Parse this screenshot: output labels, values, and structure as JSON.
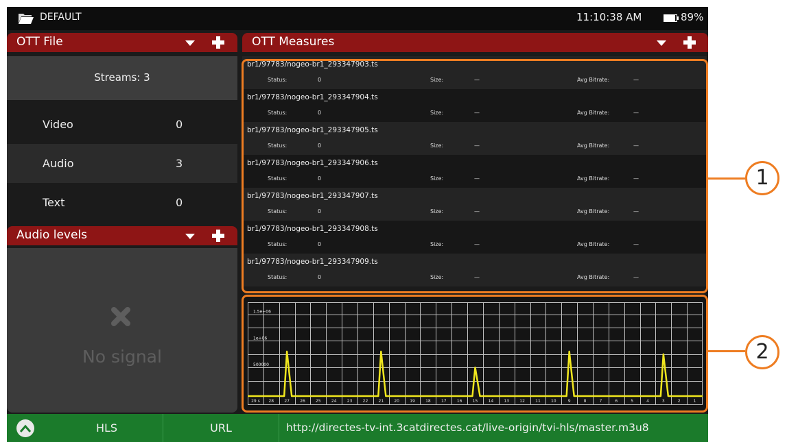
{
  "topbar": {
    "profile": "DEFAULT",
    "time": "11:10:38 AM",
    "battery": "89%",
    "icons": {
      "folder": "folder-open-icon",
      "battery": "battery-icon"
    }
  },
  "ott_file": {
    "title": "OTT File",
    "streams": "Streams: 3",
    "rows": [
      {
        "label": "Video",
        "value": "0"
      },
      {
        "label": "Audio",
        "value": "3"
      },
      {
        "label": "Text",
        "value": "0"
      }
    ]
  },
  "audio_levels": {
    "title": "Audio levels",
    "no_signal": "No signal",
    "icon": "x-icon"
  },
  "ott_measures": {
    "title": "OTT Measures",
    "status_label": "Status:",
    "size_label": "Size:",
    "bitrate_label": "Avg Bitrate:",
    "items": [
      {
        "file": "br1/97783/nogeo-br1_293347903.ts",
        "status": "0",
        "size": "—",
        "bitrate": "—"
      },
      {
        "file": "br1/97783/nogeo-br1_293347904.ts",
        "status": "0",
        "size": "—",
        "bitrate": "—"
      },
      {
        "file": "br1/97783/nogeo-br1_293347905.ts",
        "status": "0",
        "size": "—",
        "bitrate": "—"
      },
      {
        "file": "br1/97783/nogeo-br1_293347906.ts",
        "status": "0",
        "size": "—",
        "bitrate": "—"
      },
      {
        "file": "br1/97783/nogeo-br1_293347907.ts",
        "status": "0",
        "size": "—",
        "bitrate": "—"
      },
      {
        "file": "br1/97783/nogeo-br1_293347908.ts",
        "status": "0",
        "size": "—",
        "bitrate": "—"
      },
      {
        "file": "br1/97783/nogeo-br1_293347909.ts",
        "status": "0",
        "size": "—",
        "bitrate": "—"
      }
    ]
  },
  "chart_data": {
    "type": "line",
    "x": [
      29,
      28,
      27,
      26,
      25,
      24,
      23,
      22,
      21,
      20,
      19,
      18,
      17,
      16,
      15,
      14,
      13,
      12,
      11,
      10,
      9,
      8,
      7,
      6,
      5,
      4,
      3,
      2,
      1
    ],
    "x_tick_labels": [
      "29 s",
      "28",
      "27",
      "26",
      "25",
      "24",
      "23",
      "22",
      "21",
      "20",
      "19",
      "18",
      "17",
      "16",
      "15",
      "14",
      "13",
      "12",
      "11",
      "10",
      "9",
      "8",
      "7",
      "6",
      "5",
      "4",
      "3",
      "2",
      "1"
    ],
    "y_tick_labels": [
      "500000",
      "1e+06",
      "1.5e+06"
    ],
    "ylim": [
      0,
      1650000
    ],
    "series": [
      {
        "color": "#f0e61e",
        "values": [
          0,
          0,
          800000,
          0,
          0,
          0,
          0,
          0,
          800000,
          0,
          0,
          0,
          0,
          0,
          500000,
          0,
          0,
          0,
          0,
          0,
          800000,
          0,
          0,
          0,
          0,
          0,
          750000,
          0,
          0
        ]
      }
    ],
    "grid": true
  },
  "bottombar": {
    "home_icon": "chevron-up-icon",
    "tab1": "HLS",
    "tab2": "URL",
    "url": "http://directes-tv-int.3catdirectes.cat/live-origin/tvi-hls/master.m3u8"
  },
  "callouts": [
    "1",
    "2"
  ],
  "colors": {
    "header_red": "#8e1515",
    "footer_green": "#1b7b2b",
    "callout_orange": "#ee7d22",
    "trace_yellow": "#f0e61e"
  }
}
